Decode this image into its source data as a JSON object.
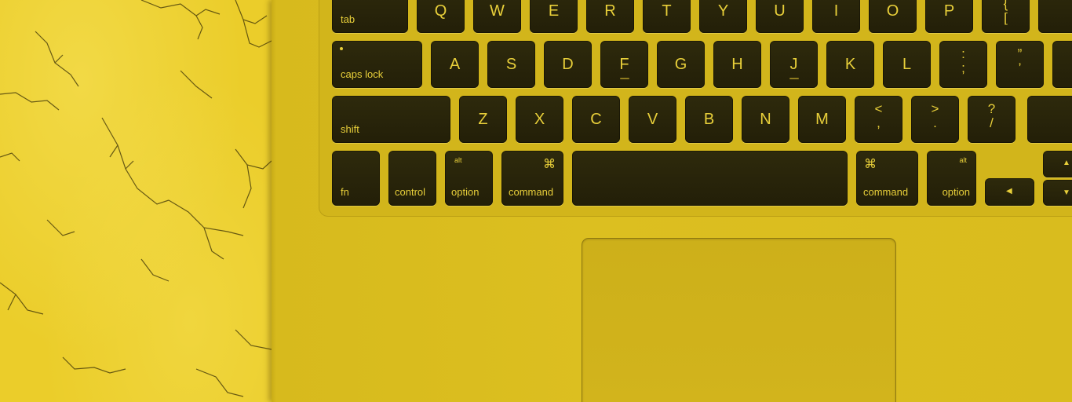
{
  "scene": {
    "colors": {
      "tint": "#e0c21f",
      "marble": "#ebcd2a",
      "key_cap": "#2a260b",
      "key_legend": "#e8cf3a"
    }
  },
  "keyboard": {
    "row1": [
      "tab",
      "Q",
      "W",
      "E",
      "R",
      "T",
      "Y",
      "U",
      "I",
      "O",
      "P"
    ],
    "row1_bracket": {
      "upper": "{",
      "lower": "["
    },
    "row2": [
      "caps lock",
      "A",
      "S",
      "D",
      "F",
      "G",
      "H",
      "J",
      "K",
      "L"
    ],
    "row2_punct": [
      {
        "upper": ":",
        "lower": ";"
      },
      {
        "upper": "”",
        "lower": "’"
      }
    ],
    "row3": [
      "shift",
      "Z",
      "X",
      "C",
      "V",
      "B",
      "N",
      "M"
    ],
    "row3_punct": [
      {
        "upper": "<",
        "lower": ","
      },
      {
        "upper": ">",
        "lower": "."
      },
      {
        "upper": "?",
        "lower": "/"
      }
    ],
    "bottom": {
      "fn": "fn",
      "control": "control",
      "option_left": {
        "label": "option",
        "alt": "alt"
      },
      "command_left": {
        "label": "command",
        "symbol": "⌘"
      },
      "command_right": {
        "label": "command",
        "symbol": "⌘"
      },
      "option_right": {
        "label": "option",
        "alt": "alt"
      },
      "arrow_left": "◀",
      "arrow_up": "▲",
      "arrow_down": "▼"
    }
  }
}
